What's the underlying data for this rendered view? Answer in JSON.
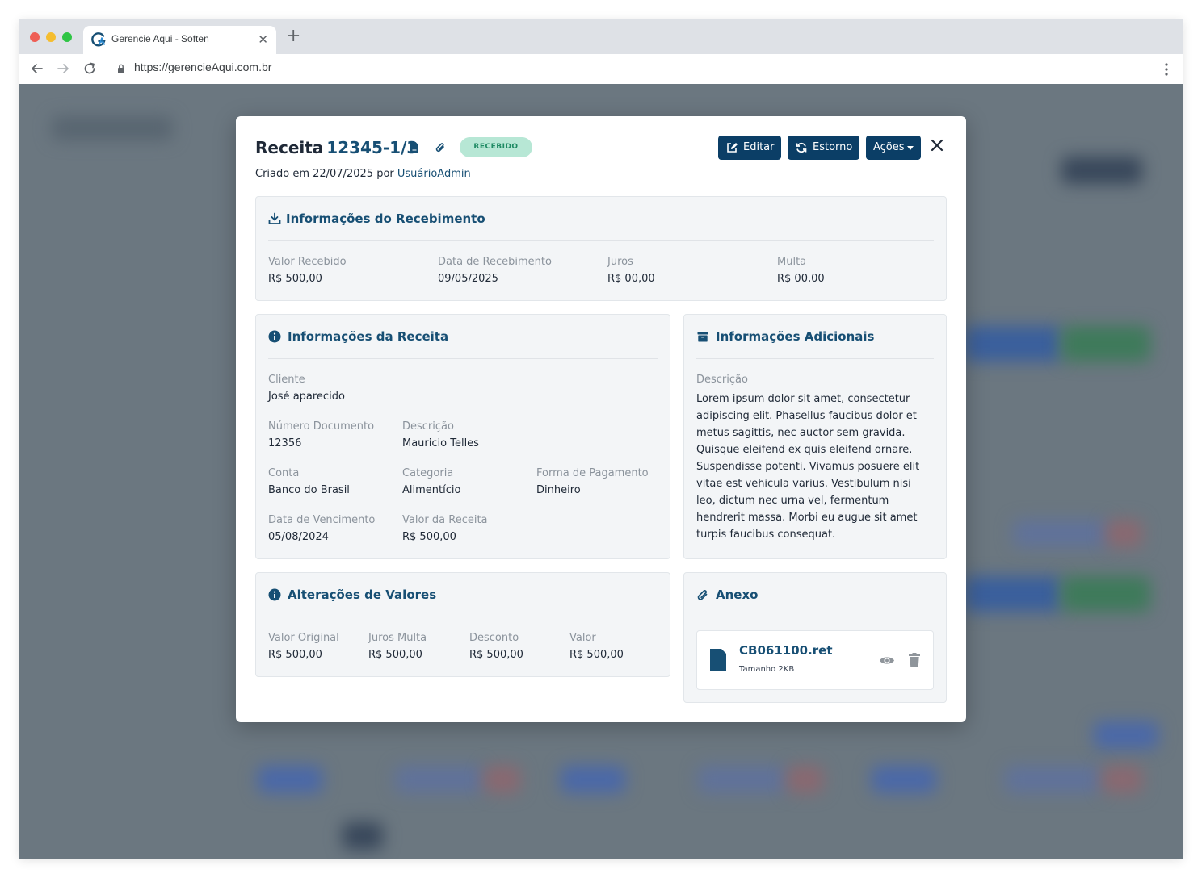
{
  "browser": {
    "tab_title": "Gerencie Aqui - Soften",
    "url": "https://gerencieAqui.com.br"
  },
  "modal": {
    "title_prefix": "Receita",
    "title_code": "12345-1/3",
    "status_badge": "RECEBIDO",
    "created_text": "Criado em 22/07/2025 por",
    "created_user": "UsuárioAdmin",
    "buttons": {
      "edit": "Editar",
      "refund": "Estorno",
      "actions": "Ações"
    }
  },
  "recebimento": {
    "title": "Informações do Recebimento",
    "fields": [
      {
        "label": "Valor Recebido",
        "value": "R$ 500,00"
      },
      {
        "label": "Data de Recebimento",
        "value": "09/05/2025"
      },
      {
        "label": "Juros",
        "value": "R$ 00,00"
      },
      {
        "label": "Multa",
        "value": "R$ 00,00"
      }
    ]
  },
  "receita": {
    "title": "Informações da Receita",
    "cliente": {
      "label": "Cliente",
      "value": "José aparecido"
    },
    "numero_documento": {
      "label": "Número Documento",
      "value": "12356"
    },
    "descricao": {
      "label": "Descrição",
      "value": "Mauricio Telles"
    },
    "conta": {
      "label": "Conta",
      "value": "Banco do Brasil"
    },
    "categoria": {
      "label": "Categoria",
      "value": "Alimentício"
    },
    "forma_pagamento": {
      "label": "Forma de Pagamento",
      "value": "Dinheiro"
    },
    "data_vencimento": {
      "label": "Data de Vencimento",
      "value": "05/08/2024"
    },
    "valor_receita": {
      "label": "Valor da Receita",
      "value": "R$ 500,00"
    }
  },
  "adicionais": {
    "title": "Informações Adicionais",
    "desc_label": "Descrição",
    "desc_text": "Lorem ipsum dolor sit amet, consectetur adipiscing elit. Phasellus faucibus dolor et metus sagittis, nec auctor sem gravida. Quisque eleifend ex quis eleifend ornare. Suspendisse potenti. Vivamus posuere elit vitae est vehicula varius. Vestibulum nisi leo, dictum nec urna vel, fermentum hendrerit massa. Morbi eu augue sit amet turpis faucibus consequat."
  },
  "alteracoes": {
    "title": "Alterações de Valores",
    "fields": [
      {
        "label": "Valor Original",
        "value": "R$ 500,00"
      },
      {
        "label": "Juros Multa",
        "value": "R$ 500,00"
      },
      {
        "label": "Desconto",
        "value": "R$ 500,00"
      },
      {
        "label": "Valor",
        "value": "R$ 500,00"
      }
    ]
  },
  "anexo": {
    "title": "Anexo",
    "file_name": "CB061100.ret",
    "file_size": "Tamanho 2KB"
  },
  "colors": {
    "primary": "#0b3e66",
    "heading": "#174f74",
    "badge_bg": "#b7e7d5",
    "badge_text": "#1e8a63",
    "overlay": "#6b7780"
  }
}
